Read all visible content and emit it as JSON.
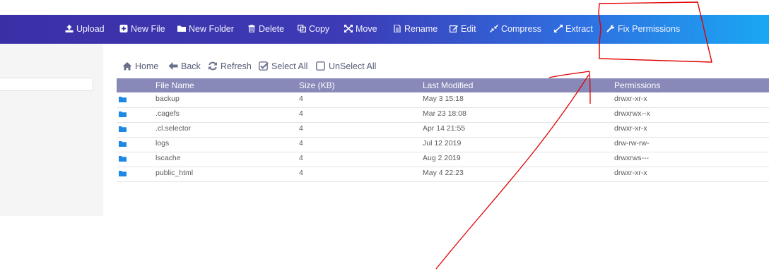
{
  "toolbar": {
    "items": [
      {
        "label": "Upload",
        "icon": "upload-icon"
      },
      {
        "label": "New File",
        "icon": "plus-square-icon"
      },
      {
        "label": "New Folder",
        "icon": "folder-icon"
      },
      {
        "label": "Delete",
        "icon": "trash-icon"
      },
      {
        "label": "Copy",
        "icon": "copy-icon"
      },
      {
        "label": "Move",
        "icon": "move-arrows-icon"
      },
      {
        "label": "Rename",
        "icon": "file-icon"
      },
      {
        "label": "Edit",
        "icon": "edit-icon"
      },
      {
        "label": "Compress",
        "icon": "compress-icon"
      },
      {
        "label": "Extract",
        "icon": "expand-icon"
      },
      {
        "label": "Fix Permissions",
        "icon": "wrench-icon"
      }
    ],
    "gradient": [
      "#3b2fa6",
      "#1aa7f3"
    ]
  },
  "actions": {
    "items": [
      {
        "label": "Home",
        "icon": "home-icon"
      },
      {
        "label": "Back",
        "icon": "arrow-left-icon"
      },
      {
        "label": "Refresh",
        "icon": "refresh-icon"
      },
      {
        "label": "Select All",
        "icon": "checked-box-icon"
      },
      {
        "label": "UnSelect All",
        "icon": "empty-box-icon"
      }
    ]
  },
  "table": {
    "headers": [
      "File Name",
      "Size (KB)",
      "Last Modified",
      "Permissions"
    ],
    "rows": [
      {
        "name": "backup",
        "size": "4",
        "modified": "May 3 15:18",
        "perms": "drwxr-xr-x"
      },
      {
        "name": ".cagefs",
        "size": "4",
        "modified": "Mar 23 18:08",
        "perms": "drwxrwx--x"
      },
      {
        "name": ".cl.selector",
        "size": "4",
        "modified": "Apr 14 21:55",
        "perms": "drwxr-xr-x"
      },
      {
        "name": "logs",
        "size": "4",
        "modified": "Jul 12 2019",
        "perms": "drw-rw-rw-"
      },
      {
        "name": "lscache",
        "size": "4",
        "modified": "Aug 2 2019",
        "perms": "drwxrws---"
      },
      {
        "name": "public_html",
        "size": "4",
        "modified": "May 4 22:23",
        "perms": "drwxr-xr-x"
      }
    ],
    "header_color": "#8889b9",
    "folder_color": "#1e88e5"
  },
  "annotation": {
    "color": "#e00000"
  }
}
